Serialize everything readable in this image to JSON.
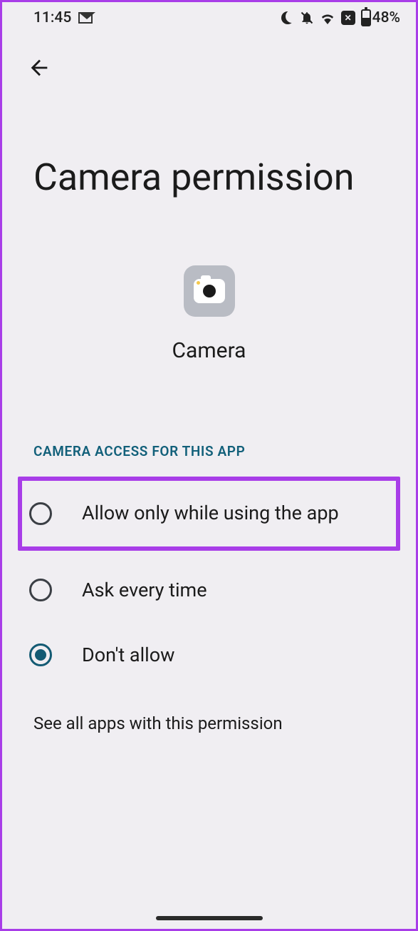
{
  "status_bar": {
    "time": "11:45",
    "battery_pct": "48%"
  },
  "page": {
    "title": "Camera permission",
    "app_name": "Camera",
    "section_header": "CAMERA ACCESS FOR THIS APP",
    "footer_link": "See all apps with this permission"
  },
  "options": [
    {
      "label": "Allow only while using the app",
      "selected": false,
      "highlighted": true
    },
    {
      "label": "Ask every time",
      "selected": false,
      "highlighted": false
    },
    {
      "label": "Don't allow",
      "selected": true,
      "highlighted": false
    }
  ]
}
